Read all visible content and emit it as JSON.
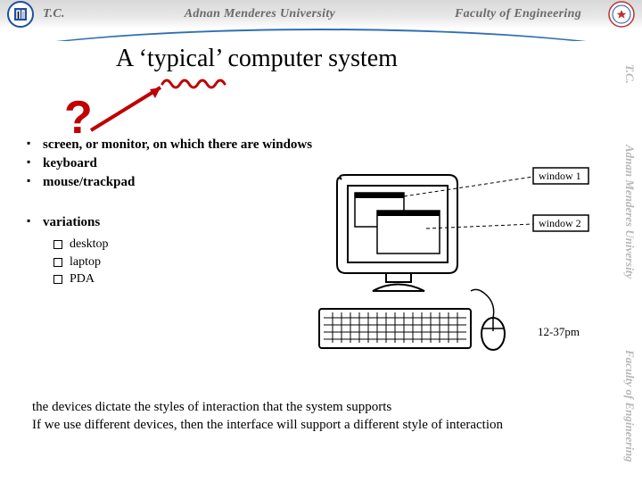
{
  "header": {
    "tc": "T.C.",
    "university": "Adnan Menderes University",
    "faculty": "Faculty of Engineering"
  },
  "sidebar": {
    "tc": "T.C.",
    "university": "Adnan Menderes University",
    "faculty": "Faculty of Engineering"
  },
  "slide": {
    "title": "A ‘typical’ computer system",
    "question_mark": "?",
    "bullets": {
      "b1": "screen, or monitor, on which there are windows",
      "b2": "keyboard",
      "b3": "mouse/trackpad",
      "b4": "variations"
    },
    "subbullets": {
      "s1": "desktop",
      "s2": "laptop",
      "s3": "PDA"
    },
    "figure": {
      "window1_label": "window 1",
      "window2_label": "window 2",
      "caption": "12-37pm"
    },
    "closing": {
      "line1": "the devices dictate the styles of interaction that the system supports",
      "line2": "If we use different devices, then the interface will support a different style of interaction"
    }
  }
}
